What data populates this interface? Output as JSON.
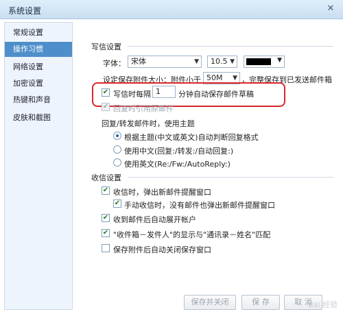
{
  "window": {
    "title": "系统设置",
    "close_glyph": "✕"
  },
  "sidebar": {
    "items": [
      {
        "label": "常规设置"
      },
      {
        "label": "操作习惯"
      },
      {
        "label": "网络设置"
      },
      {
        "label": "加密设置"
      },
      {
        "label": "热键和声音"
      },
      {
        "label": "皮肤和截图"
      }
    ],
    "active_index": 1
  },
  "compose": {
    "section_title": "写信设置",
    "font_label": "字体：",
    "font_value": "宋体",
    "size_value": "10.5",
    "color_value": "#000000",
    "attach_size_label": "设定保存附件大小：附件小于",
    "attach_size_value": "50M",
    "attach_size_suffix": "，完整保存到已发送邮件箱",
    "autosave_label": "写信时每隔",
    "autosave_value": "1",
    "autosave_suffix": "分钟自动保存邮件草稿",
    "quote_label": "回复时引用原邮件",
    "reply_subject_label": "回复/转发邮件时，使用主题",
    "reply_options": [
      "根据主题(中文或英文)自动判断回复格式",
      "使用中文(回复:/转发:/自动回复:)",
      "使用英文(Re:/Fw:/AutoReply:)"
    ]
  },
  "receive": {
    "section_title": "收信设置",
    "options": [
      "收信时，弹出新邮件提醒窗口",
      "手动收信时，没有邮件也弹出新邮件提醒窗口",
      "收到邮件后自动展开帐户",
      "\"收件箱－发件人\"的显示与\"通讯录－姓名\"匹配",
      "保存附件后自动关闭保存窗口"
    ]
  },
  "buttons": {
    "save_close": "保存并关闭",
    "save": "保 存",
    "cancel": "取 消"
  },
  "watermark": "Bai 经验"
}
